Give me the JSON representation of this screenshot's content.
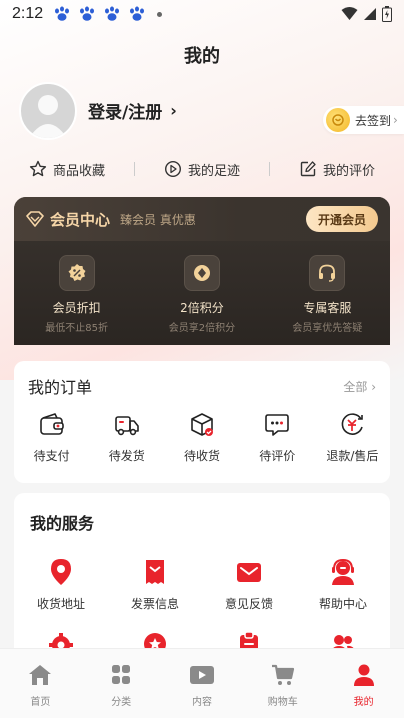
{
  "status_bar": {
    "time": "2:12"
  },
  "header": {
    "title": "我的"
  },
  "profile": {
    "login_label": "登录/注册",
    "chevron": "›",
    "signin_label": "去签到",
    "signin_chevron": "›"
  },
  "quick_links": [
    {
      "label": "商品收藏",
      "icon": "star-icon"
    },
    {
      "label": "我的足迹",
      "icon": "footprint-icon"
    },
    {
      "label": "我的评价",
      "icon": "edit-icon"
    }
  ],
  "vip": {
    "title": "会员中心",
    "subtitle": "臻会员 真优惠",
    "button": "开通会员",
    "perks": [
      {
        "title": "会员折扣",
        "desc": "最低不止85折",
        "icon": "discount-icon"
      },
      {
        "title": "2倍积分",
        "desc": "会员享2倍积分",
        "icon": "points-icon"
      },
      {
        "title": "专属客服",
        "desc": "会员享优先答疑",
        "icon": "headset-icon"
      }
    ],
    "colors": {
      "gold": "#f6d6a8",
      "dark": "#2b2622"
    }
  },
  "orders": {
    "title": "我的订单",
    "more": "全部 ›",
    "items": [
      {
        "label": "待支付",
        "icon": "wallet-icon"
      },
      {
        "label": "待发货",
        "icon": "truck-icon"
      },
      {
        "label": "待收货",
        "icon": "package-icon"
      },
      {
        "label": "待评价",
        "icon": "comment-icon"
      },
      {
        "label": "退款/售后",
        "icon": "refund-icon"
      }
    ]
  },
  "services": {
    "title": "我的服务",
    "items": [
      {
        "label": "收货地址",
        "icon": "location-icon"
      },
      {
        "label": "发票信息",
        "icon": "invoice-icon"
      },
      {
        "label": "意见反馈",
        "icon": "mail-icon"
      },
      {
        "label": "帮助中心",
        "icon": "service-agent-icon"
      },
      {
        "label": "",
        "icon": "settings-icon"
      },
      {
        "label": "",
        "icon": "badge-star-icon"
      },
      {
        "label": "",
        "icon": "clipboard-icon"
      },
      {
        "label": "",
        "icon": "users-icon"
      }
    ]
  },
  "tabbar": [
    {
      "label": "首页",
      "icon": "home-icon",
      "active": false
    },
    {
      "label": "分类",
      "icon": "category-icon",
      "active": false
    },
    {
      "label": "内容",
      "icon": "video-icon",
      "active": false
    },
    {
      "label": "购物车",
      "icon": "cart-icon",
      "active": false
    },
    {
      "label": "我的",
      "icon": "profile-icon",
      "active": true
    }
  ],
  "colors": {
    "accent": "#e8242c",
    "icon_red": "#e8242c"
  }
}
